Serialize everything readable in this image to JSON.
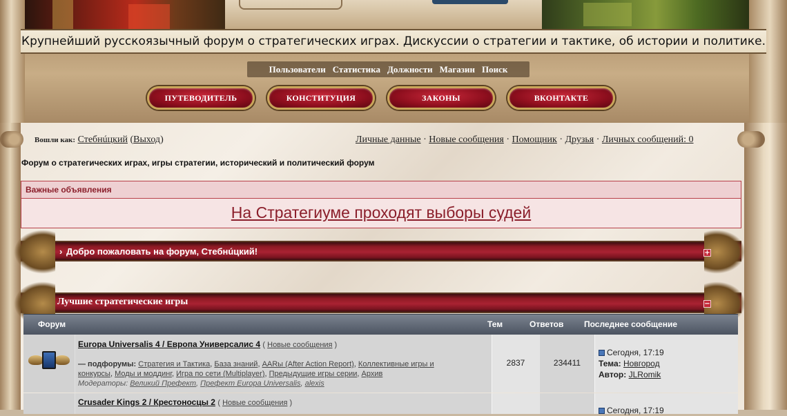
{
  "header": {
    "tagline": "Крупнейший русскоязычный форум о стратегических играх. Дискуссии о стратегии и тактике, об истории и политике.",
    "nav": [
      "Пользователи",
      "Статистика",
      "Должности",
      "Магазин",
      "Поиск"
    ],
    "buttons": [
      "ПУТЕВОДИТЕЛЬ",
      "КОНСТИТУЦИЯ",
      "ЗАКОНЫ",
      "ВКОНТАКТЕ"
    ]
  },
  "userbar": {
    "logged_in_label": "Вошли как:",
    "username": "Стебнúцкий",
    "open_paren": "(",
    "logout": "Выход",
    "close_paren": ")",
    "links": [
      "Личные данные",
      "Новые сообщения",
      "Помощник",
      "Друзья",
      "Личных сообщений: 0"
    ],
    "separator": "·"
  },
  "site_title": "Форум о стратегических играх, игры стратегии, исторический и политический форум",
  "announcements": {
    "header": "Важные объявления",
    "text": "На Стратегиуме проходят выборы судей"
  },
  "welcome": {
    "arrow": "›",
    "text": "Добро пожаловать на форум, Стебнúцкий!",
    "toggle": "+"
  },
  "category": {
    "title": "Лучшие стратегические игры",
    "toggle": "−",
    "columns": {
      "forum": "Форум",
      "topics": "Тем",
      "replies": "Ответов",
      "last": "Последнее сообщение"
    }
  },
  "forums": [
    {
      "title": "Europa Universalis 4 / Европа Универсалис 4",
      "new_messages": "Новые сообщения",
      "subforums_label": "— подфорумы:",
      "subforums": [
        "Стратегия и Тактика",
        "База знаний",
        "AARы (After Action Report)",
        "Коллективные игры и конкурсы",
        "Моды и моддинг",
        "Игра по сети (Multiplayer)",
        "Предыдущие игры серии",
        "Архив"
      ],
      "moderators_label": "Модераторы:",
      "moderators": [
        "Великий Префект",
        "Префект Europa Universalis",
        "alexis"
      ],
      "topics": "2837",
      "replies": "234411",
      "last_time": "Сегодня, 17:19",
      "last_topic_label": "Тема:",
      "last_topic": "Новгород",
      "last_author_label": "Автор:",
      "last_author": "JLRomik"
    },
    {
      "title": "Crusader Kings 2 / Крестоносцы 2",
      "new_messages": "Новые сообщения",
      "last_time": "Сегодня, 17:19"
    }
  ],
  "colors": {
    "banner_red": "#a92232",
    "announce_border": "#b7404a",
    "thead": "#5b6370"
  }
}
